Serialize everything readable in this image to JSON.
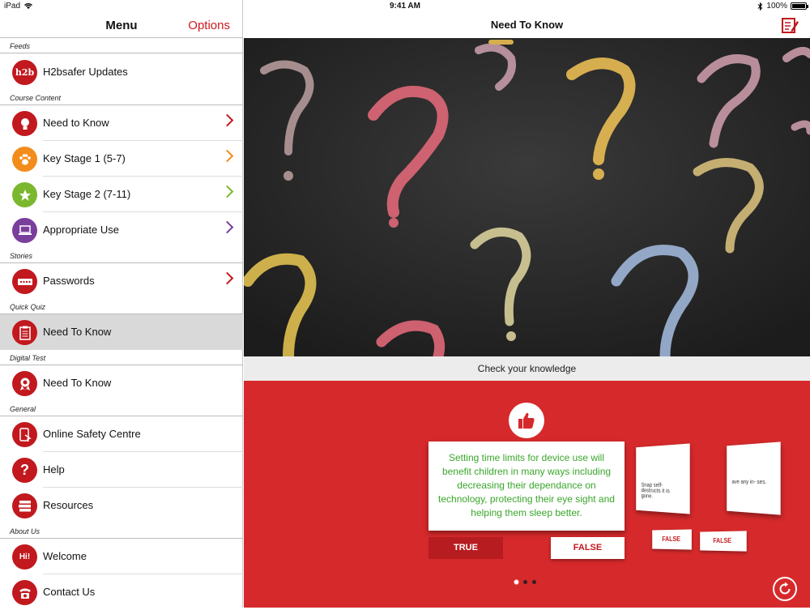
{
  "status_bar": {
    "device": "iPad",
    "time": "9:41 AM",
    "battery": "100%"
  },
  "sidebar": {
    "title": "Menu",
    "options_label": "Options",
    "sections": {
      "feeds": "Feeds",
      "course_content": "Course Content",
      "stories": "Stories",
      "quick_quiz": "Quick Quiz",
      "digital_test": "Digital Test",
      "general": "General",
      "about_us": "About Us"
    },
    "items": {
      "h2bsafer_updates": "H2bsafer Updates",
      "need_to_know_course": "Need to Know",
      "key_stage_1": "Key Stage 1 (5-7)",
      "key_stage_2": "Key Stage 2 (7-11)",
      "appropriate_use": "Appropriate Use",
      "passwords": "Passwords",
      "need_to_know_quiz": "Need To Know",
      "need_to_know_test": "Need To Know",
      "online_safety_centre": "Online Safety Centre",
      "help": "Help",
      "resources": "Resources",
      "welcome": "Welcome",
      "contact_us": "Contact Us"
    },
    "logo_text": "h2b",
    "welcome_icon_text": "Hi!"
  },
  "main": {
    "title": "Need To Know",
    "knowledge_bar": "Check your knowledge",
    "quiz": {
      "question": "Setting time limits for device use will benefit children in many ways including decreasing their dependance on technology, protecting their eye sight and helping them sleep better.",
      "true_label": "TRUE",
      "false_label": "FALSE",
      "back_card_1_text": "Snap self-destructs it is gone.",
      "back_card_2_text": "ave any in- ses.",
      "back_false_1": "FALSE",
      "back_false_2": "FALSE",
      "current_card_index": 1,
      "total_cards": 3
    }
  },
  "colors": {
    "brand_red": "#cc1a1f",
    "panel_red": "#d6292b",
    "answer_green": "#3aa62b",
    "orange": "#f28c1c",
    "green": "#7cb82f",
    "purple": "#7a3e9d"
  },
  "icons": {
    "need_to_know_course": "lightbulb-icon",
    "key_stage_1": "paw-icon",
    "key_stage_2": "star-icon",
    "appropriate_use": "laptop-icon",
    "passwords": "password-icon",
    "need_to_know_quiz": "clipboard-icon",
    "need_to_know_test": "award-icon",
    "online_safety_centre": "tablet-touch-icon",
    "help": "question-icon",
    "resources": "books-icon",
    "welcome": "speech-bubble-icon",
    "contact_us": "phone-icon",
    "nav_action": "edit-list-icon",
    "quiz_badge": "thumbs-up-icon",
    "restart": "refresh-icon"
  }
}
